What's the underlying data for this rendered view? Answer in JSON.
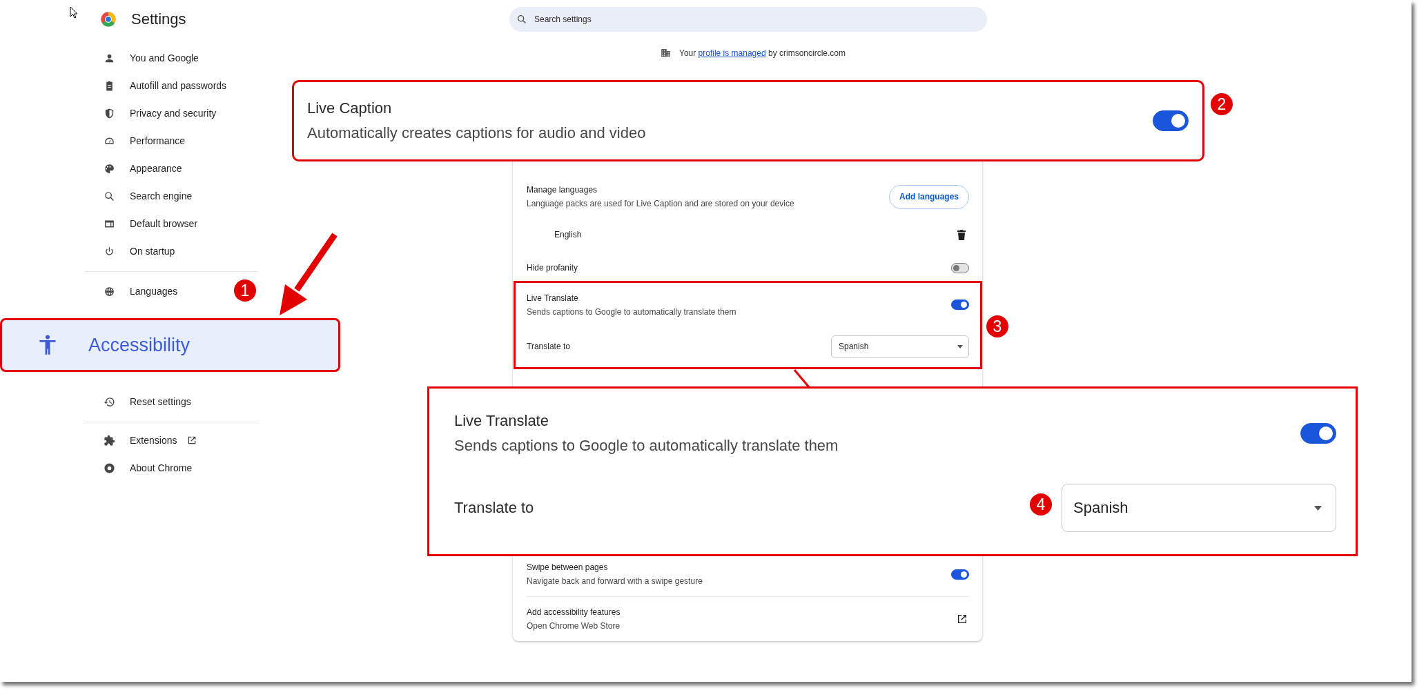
{
  "window": {
    "title": "Settings"
  },
  "sidebar": {
    "groups": [
      [
        {
          "label": "You and Google",
          "kind": "page"
        },
        {
          "label": "Autofill and passwords",
          "kind": "page"
        },
        {
          "label": "Privacy and security",
          "kind": "page"
        },
        {
          "label": "Performance",
          "kind": "page"
        },
        {
          "label": "Appearance",
          "kind": "page"
        },
        {
          "label": "Search engine",
          "kind": "page"
        },
        {
          "label": "Default browser",
          "kind": "page"
        },
        {
          "label": "On startup",
          "kind": "page"
        }
      ],
      [
        {
          "label": "Languages",
          "kind": "page"
        },
        {
          "label": "Reset settings",
          "kind": "page"
        }
      ],
      [
        {
          "label": "Extensions",
          "kind": "external"
        },
        {
          "label": "About Chrome",
          "kind": "page"
        }
      ]
    ]
  },
  "search": {
    "placeholder": "Search settings"
  },
  "managed_notice": {
    "prefix": "Your",
    "link": "profile is managed",
    "suffix": "by crimsoncircle.com"
  },
  "card": {
    "rows": [
      {
        "kind": "button",
        "title": "Manage languages",
        "subtitle": "Language packs are used for Live Caption and are stored on your device",
        "button": "Add languages"
      },
      {
        "kind": "language",
        "title": "English"
      },
      {
        "kind": "toggle",
        "title": "Hide profanity",
        "on": false
      },
      {
        "kind": "toggle",
        "title": "Live Translate",
        "subtitle": "Sends captions to Google to automatically translate them",
        "on": true
      },
      {
        "kind": "select",
        "title": "Translate to",
        "value": "Spanish"
      }
    ],
    "lower_rows": [
      {
        "kind": "toggle",
        "title": "Swipe between pages",
        "subtitle": "Navigate back and forward with a swipe gesture",
        "on": true
      },
      {
        "kind": "external",
        "title": "Add accessibility features",
        "subtitle": "Open Chrome Web Store"
      }
    ]
  },
  "callouts": {
    "badges": [
      "1",
      "2",
      "3",
      "4"
    ],
    "accessibility": {
      "label": "Accessibility"
    },
    "live_caption": {
      "title": "Live Caption",
      "subtitle": "Automatically creates captions for audio and video",
      "on": true
    },
    "live_translate": {
      "title": "Live Translate",
      "subtitle": "Sends captions to Google to automatically translate them",
      "on": true,
      "label": "Translate to",
      "value": "Spanish"
    }
  }
}
